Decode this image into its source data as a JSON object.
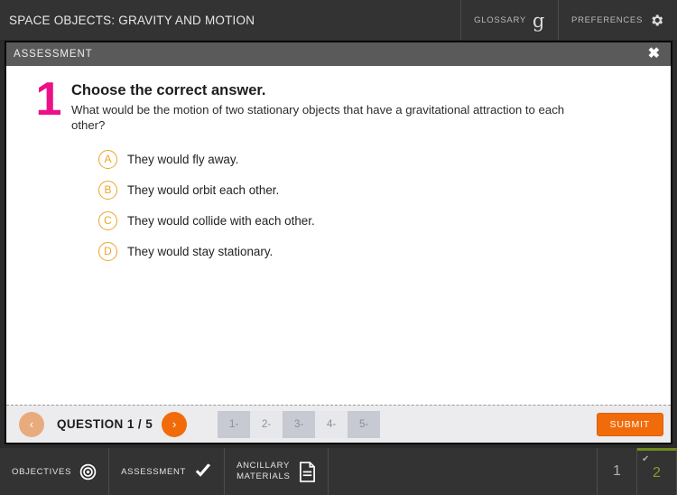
{
  "header": {
    "title": "SPACE OBJECTS: GRAVITY AND MOTION",
    "glossary_label": "GLOSSARY",
    "glossary_icon": "glossary-g-icon",
    "preferences_label": "PREFERENCES",
    "preferences_icon": "gear-icon"
  },
  "panel": {
    "title": "ASSESSMENT",
    "close_label": "✖",
    "close_icon": "close-icon"
  },
  "question": {
    "number": "1",
    "number_color": "#ec1089",
    "prompt": "Choose the correct answer.",
    "stem": "What would be the motion of two stationary objects that have a gravitational attraction to each other?",
    "choices": [
      {
        "letter": "A",
        "text": "They would fly away."
      },
      {
        "letter": "B",
        "text": "They would orbit each other."
      },
      {
        "letter": "C",
        "text": "They would collide with each other."
      },
      {
        "letter": "D",
        "text": "They would stay stationary."
      }
    ],
    "choice_color": "#f0a229"
  },
  "nav": {
    "prev_icon": "chevron-left-icon",
    "prev_label": "‹",
    "next_icon": "chevron-right-icon",
    "next_label": "›",
    "question_label": "QUESTION 1 / 5",
    "tabs": [
      {
        "label": "1-",
        "shade": "dark"
      },
      {
        "label": "2-",
        "shade": "light"
      },
      {
        "label": "3-",
        "shade": "dark"
      },
      {
        "label": "4-",
        "shade": "light"
      },
      {
        "label": "5-",
        "shade": "dark"
      }
    ],
    "submit_label": "SUBMIT",
    "accent_color": "#f26b0a"
  },
  "footer": {
    "objectives_label": "OBJECTIVES",
    "objectives_icon": "target-icon",
    "assessment_label": "ASSESSMENT",
    "assessment_icon": "check-icon",
    "ancillary_line1": "ANCILLARY",
    "ancillary_line2": "MATERIALS",
    "ancillary_icon": "document-icon",
    "page_numbers": [
      {
        "label": "1",
        "active": false,
        "check": ""
      },
      {
        "label": "2",
        "active": true,
        "check": "✔"
      }
    ],
    "active_color": "#8a9a2b"
  }
}
